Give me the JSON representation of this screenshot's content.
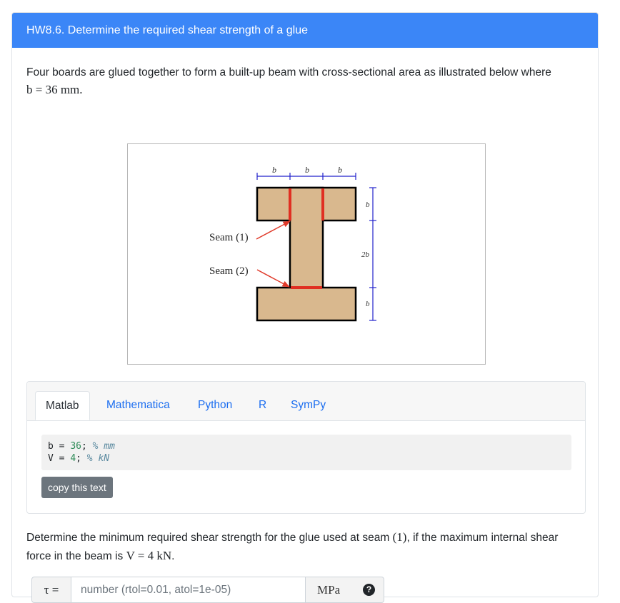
{
  "header": {
    "title": "HW8.6. Determine the required shear strength of a glue"
  },
  "intro": {
    "text": "Four boards are glued together to form a built-up beam with cross-sectional area as illustrated below where",
    "value": "b = 36 mm."
  },
  "figure": {
    "dim_b": "b",
    "dim_2b": "2b",
    "seam1_label": "Seam (1)",
    "seam2_label": "Seam (2)",
    "colors": {
      "board_fill": "#d9b88e",
      "seam": "#e02f22",
      "dimension": "#2222cc",
      "arrow": "#e03a2a"
    }
  },
  "code_panel": {
    "tabs": [
      {
        "label": "Matlab"
      },
      {
        "label": "Mathematica"
      },
      {
        "label": "Python"
      },
      {
        "label": "R"
      },
      {
        "label": "SymPy"
      }
    ],
    "active_tab": "Matlab",
    "lines": [
      {
        "var": "b",
        "op": " = ",
        "num": "36",
        "semi": ";",
        "comment": "% mm"
      },
      {
        "var": "V",
        "op": " = ",
        "num": "4",
        "semi": ";",
        "comment": "% kN"
      }
    ],
    "copy_label": "copy this text"
  },
  "question": {
    "part1": "Determine the minimum required shear strength for the glue used at seam",
    "seam": "(1)",
    "part2": ", if the maximum internal shear force in the beam is",
    "force": "V = 4 kN",
    "end": "."
  },
  "answer": {
    "symbol": "τ =",
    "placeholder": "number (rtol=0.01, atol=1e-05)",
    "unit": "MPa",
    "help_icon": "?"
  },
  "colors": {
    "header_bg": "#3b86f7",
    "link": "#1c6ef0",
    "button_bg": "#6c757d"
  }
}
